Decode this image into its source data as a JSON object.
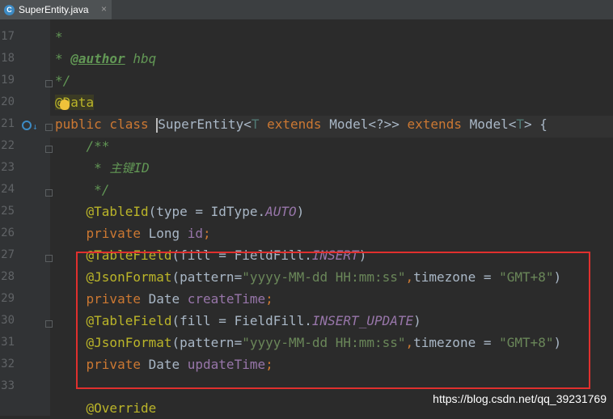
{
  "tab": {
    "icon": "java-class-icon",
    "label": "SuperEntity.java",
    "close": "×"
  },
  "watermark": "https://blog.csdn.net/qq_39231769",
  "lines": [
    {
      "n": "17",
      "tokens": [
        {
          "t": "*",
          "c": "c-doc"
        }
      ]
    },
    {
      "n": "18",
      "tokens": [
        {
          "t": "* ",
          "c": "c-doc"
        },
        {
          "t": "@author",
          "c": "c-doctag"
        },
        {
          "t": " hbq",
          "c": "c-doc"
        }
      ]
    },
    {
      "n": "19",
      "tokens": [
        {
          "t": "*/",
          "c": "c-doc"
        }
      ]
    },
    {
      "n": "20",
      "tokens": [
        {
          "t": "@Data",
          "c": "c-ann ann-hl"
        }
      ]
    },
    {
      "n": "21",
      "tokens": [
        {
          "t": "public class ",
          "c": "c-kw"
        },
        {
          "t": "SuperEntity",
          "c": "c-plain"
        },
        {
          "t": "<",
          "c": "c-plain"
        },
        {
          "t": "T",
          "c": "c-type"
        },
        {
          "t": " extends ",
          "c": "c-kw"
        },
        {
          "t": "Model<?>>",
          "c": "c-plain"
        },
        {
          "t": " extends ",
          "c": "c-kw"
        },
        {
          "t": "Model<",
          "c": "c-plain"
        },
        {
          "t": "T",
          "c": "c-type"
        },
        {
          "t": "> {",
          "c": "c-plain"
        }
      ]
    },
    {
      "n": "22",
      "tokens": [
        {
          "t": "    /**",
          "c": "c-doc"
        }
      ]
    },
    {
      "n": "23",
      "tokens": [
        {
          "t": "     * ",
          "c": "c-doc"
        },
        {
          "t": "主键",
          "c": "c-zh"
        },
        {
          "t": "ID",
          "c": "c-doc"
        }
      ]
    },
    {
      "n": "24",
      "tokens": [
        {
          "t": "     */",
          "c": "c-doc"
        }
      ]
    },
    {
      "n": "25",
      "tokens": [
        {
          "t": "    @TableId",
          "c": "c-ann"
        },
        {
          "t": "(type = IdType.",
          "c": "c-plain"
        },
        {
          "t": "AUTO",
          "c": "c-static"
        },
        {
          "t": ")",
          "c": "c-plain"
        }
      ]
    },
    {
      "n": "26",
      "tokens": [
        {
          "t": "    private ",
          "c": "c-kw"
        },
        {
          "t": "Long ",
          "c": "c-plain"
        },
        {
          "t": "id",
          "c": "c-field"
        },
        {
          "t": ";",
          "c": "c-kw"
        }
      ]
    },
    {
      "n": "27",
      "tokens": [
        {
          "t": "    @TableField",
          "c": "c-ann"
        },
        {
          "t": "(fill = FieldFill.",
          "c": "c-plain"
        },
        {
          "t": "INSERT",
          "c": "c-static"
        },
        {
          "t": ")",
          "c": "c-plain"
        }
      ]
    },
    {
      "n": "28",
      "tokens": [
        {
          "t": "    @JsonFormat",
          "c": "c-ann"
        },
        {
          "t": "(pattern=",
          "c": "c-plain"
        },
        {
          "t": "\"yyyy-MM-dd HH:mm:ss\"",
          "c": "c-str"
        },
        {
          "t": ",",
          "c": "c-kw"
        },
        {
          "t": "timezone = ",
          "c": "c-plain"
        },
        {
          "t": "\"GMT+8\"",
          "c": "c-str"
        },
        {
          "t": ")",
          "c": "c-plain"
        }
      ]
    },
    {
      "n": "29",
      "tokens": [
        {
          "t": "    private ",
          "c": "c-kw"
        },
        {
          "t": "Date ",
          "c": "c-plain"
        },
        {
          "t": "createTime",
          "c": "c-field"
        },
        {
          "t": ";",
          "c": "c-kw"
        }
      ]
    },
    {
      "n": "30",
      "tokens": [
        {
          "t": "    @TableField",
          "c": "c-ann"
        },
        {
          "t": "(fill = FieldFill.",
          "c": "c-plain"
        },
        {
          "t": "INSERT_UPDATE",
          "c": "c-static"
        },
        {
          "t": ")",
          "c": "c-plain"
        }
      ]
    },
    {
      "n": "31",
      "tokens": [
        {
          "t": "    @JsonFormat",
          "c": "c-ann"
        },
        {
          "t": "(pattern=",
          "c": "c-plain"
        },
        {
          "t": "\"yyyy-MM-dd HH:mm:ss\"",
          "c": "c-str"
        },
        {
          "t": ",",
          "c": "c-kw"
        },
        {
          "t": "timezone = ",
          "c": "c-plain"
        },
        {
          "t": "\"GMT+8\"",
          "c": "c-str"
        },
        {
          "t": ")",
          "c": "c-plain"
        }
      ]
    },
    {
      "n": "32",
      "tokens": [
        {
          "t": "    private ",
          "c": "c-kw"
        },
        {
          "t": "Date ",
          "c": "c-plain"
        },
        {
          "t": "updateTime",
          "c": "c-field"
        },
        {
          "t": ";",
          "c": "c-kw"
        }
      ]
    },
    {
      "n": "33",
      "tokens": []
    },
    {
      "n": "",
      "tokens": [
        {
          "t": "    @Override",
          "c": "c-ann"
        }
      ]
    }
  ]
}
